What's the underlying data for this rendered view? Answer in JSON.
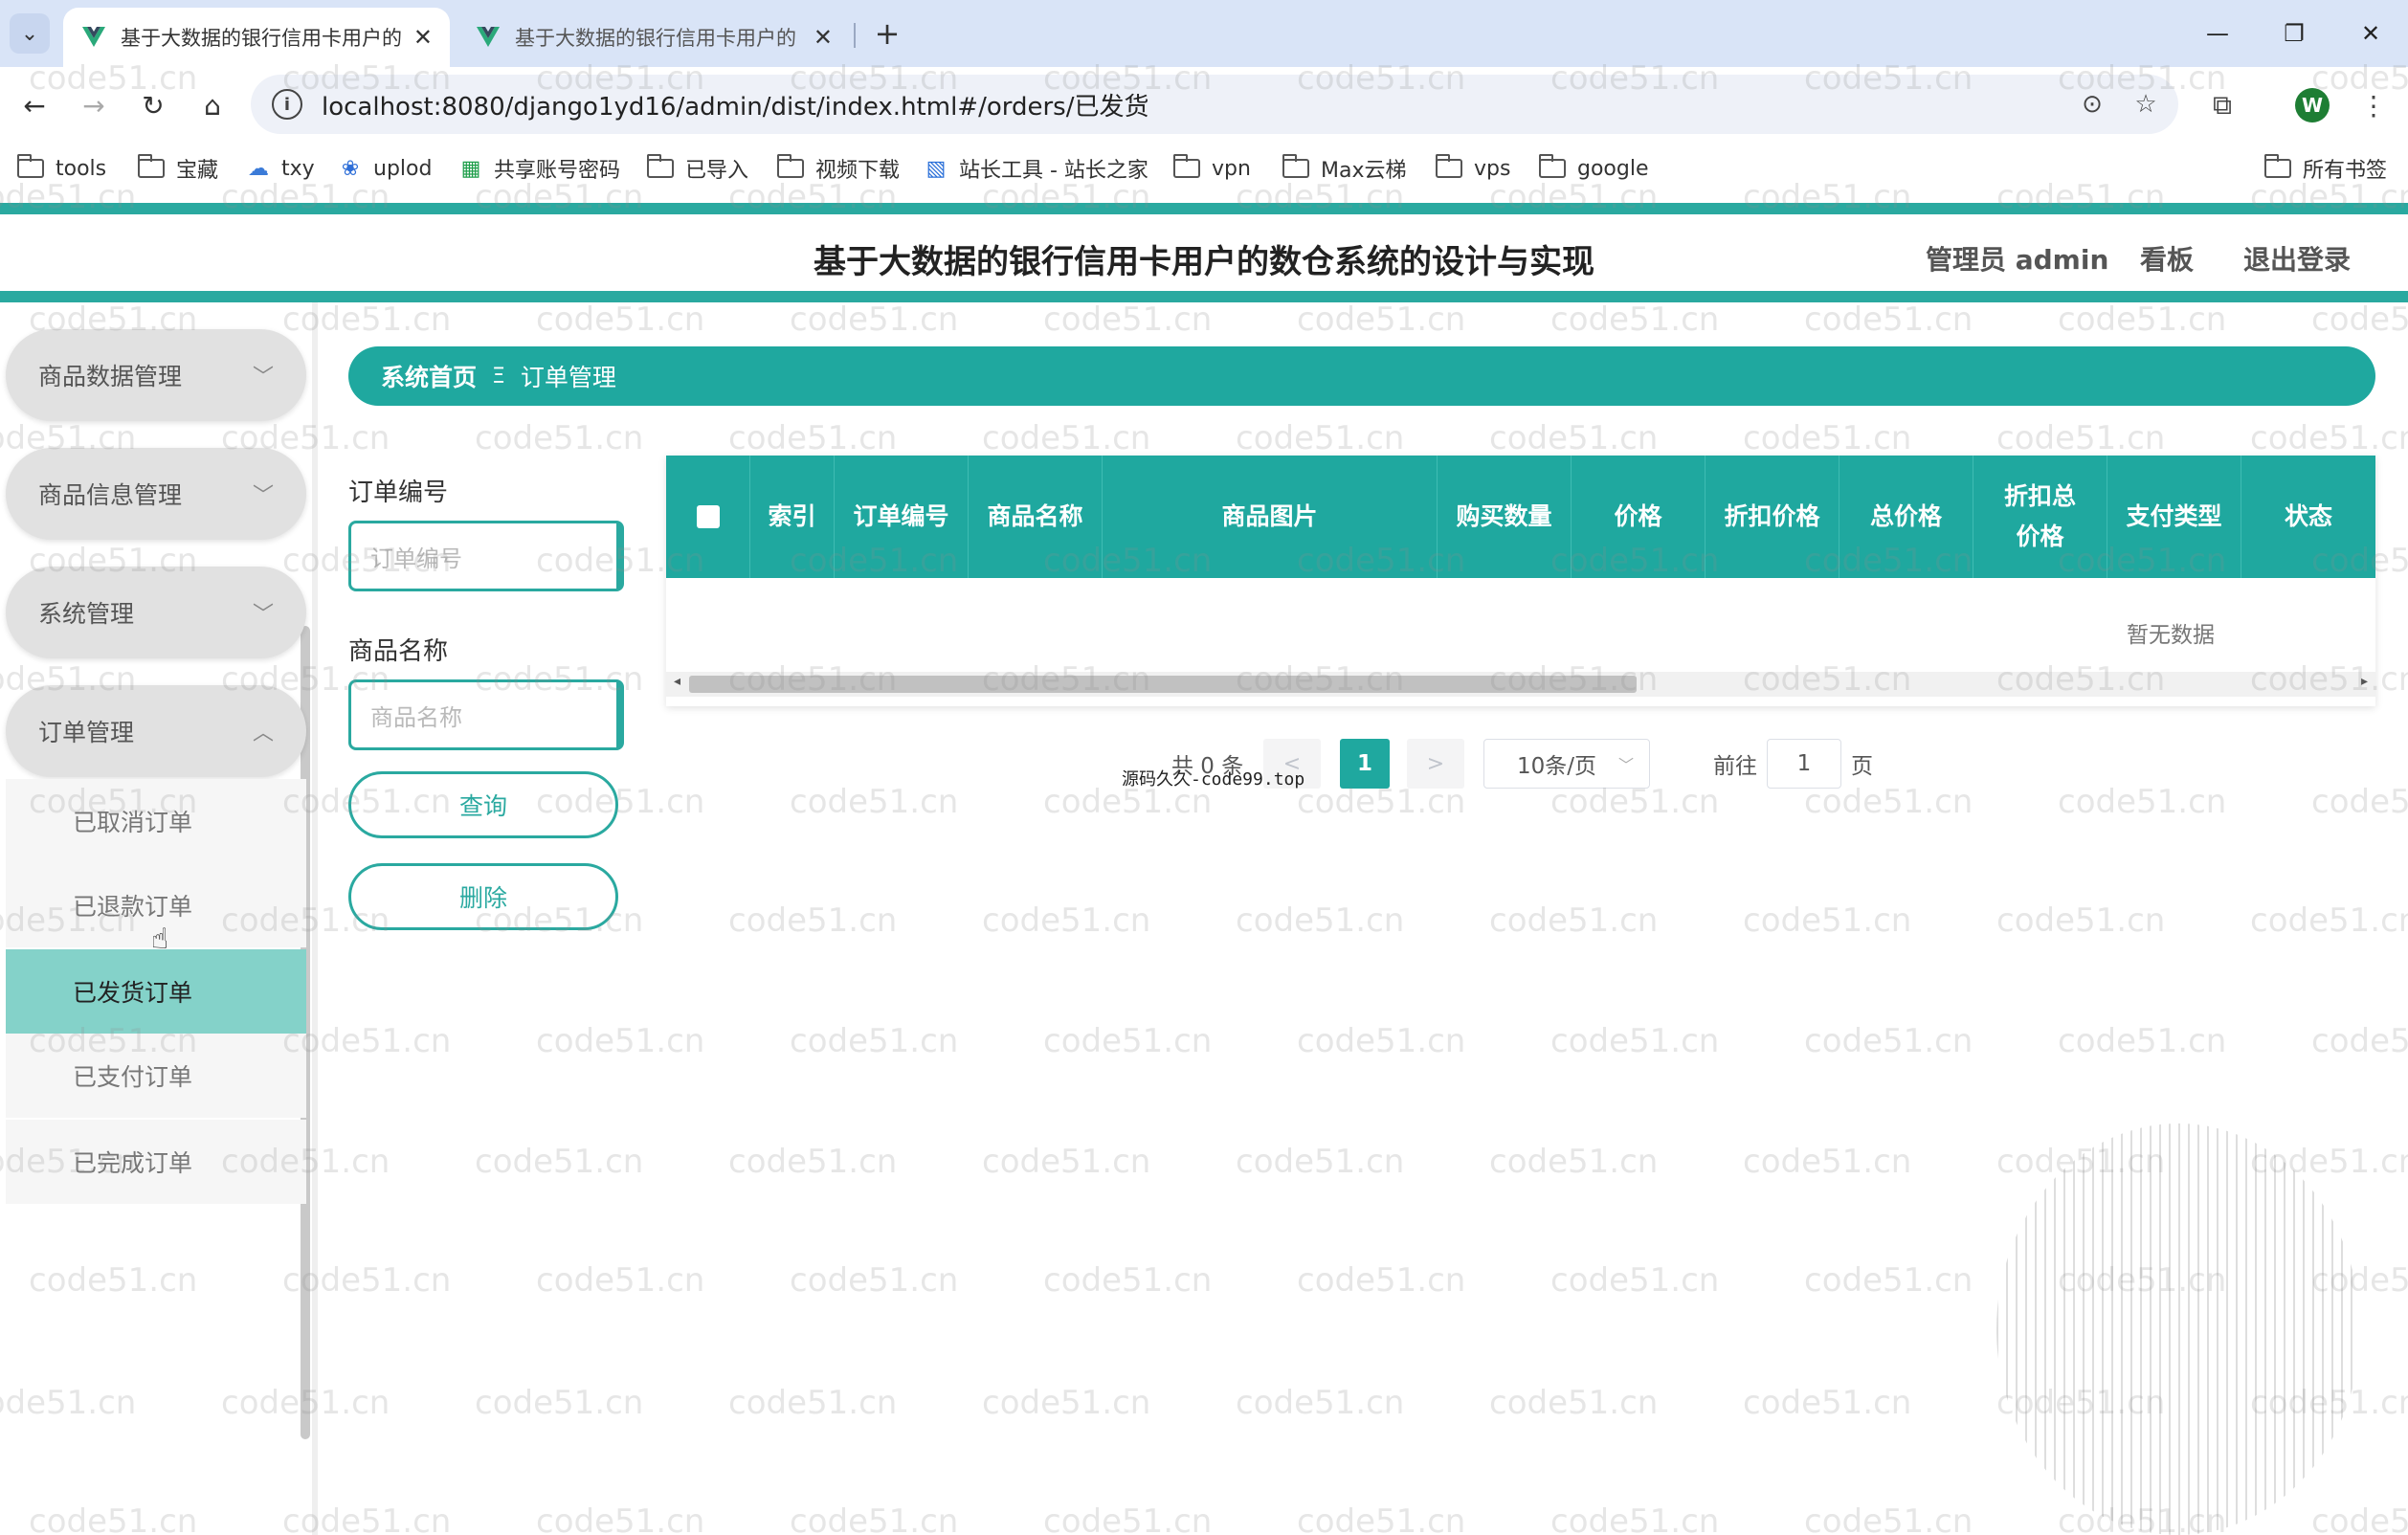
{
  "browser": {
    "tabs": [
      {
        "title": "基于大数据的银行信用卡用户的",
        "active": true
      },
      {
        "title": "基于大数据的银行信用卡用户的",
        "active": false
      }
    ],
    "url": "localhost:8080/django1yd16/admin/dist/index.html#/orders/已发货",
    "avatar_letter": "W",
    "bookmarks": [
      "tools",
      "宝藏",
      "txy",
      "uplod",
      "共享账号密码",
      "已导入",
      "视频下载",
      "站长工具 - 站长之家",
      "vpn",
      "Max云梯",
      "vps",
      "google"
    ],
    "all_bookmarks": "所有书签"
  },
  "header": {
    "title": "基于大数据的银行信用卡用户的数仓系统的设计与实现",
    "user": "管理员 admin",
    "dashboard": "看板",
    "logout": "退出登录"
  },
  "sidebar": {
    "menus": [
      {
        "label": "商品数据管理",
        "chevron": "﹀"
      },
      {
        "label": "商品信息管理",
        "chevron": "﹀"
      },
      {
        "label": "系统管理",
        "chevron": "﹀"
      },
      {
        "label": "订单管理",
        "chevron": "︿"
      }
    ],
    "submenus": [
      "已取消订单",
      "已退款订单",
      "已发货订单",
      "已支付订单",
      "已完成订单"
    ],
    "active_submenu": "已发货订单"
  },
  "breadcrumb": {
    "home": "系统首页",
    "separator": "Ξ",
    "current": "订单管理"
  },
  "search": {
    "order_no_label": "订单编号",
    "order_no_placeholder": "订单编号",
    "product_name_label": "商品名称",
    "product_name_placeholder": "商品名称",
    "query_button": "查询",
    "delete_button": "删除"
  },
  "table": {
    "columns": [
      "索引",
      "订单编号",
      "商品名称",
      "商品图片",
      "购买数量",
      "价格",
      "折扣价格",
      "总价格",
      "折扣总价格",
      "支付类型",
      "状态"
    ],
    "empty_text": "暂无数据"
  },
  "pagination": {
    "total": "共 0 条",
    "prev": "<",
    "current_page": "1",
    "next": ">",
    "page_size": "10条/页",
    "goto_label": "前往",
    "goto_value": "1",
    "page_suffix": "页"
  },
  "overlay_note": "源码久久-code99.top",
  "watermark": "code51.cn",
  "colors": {
    "accent": "#1fa89f",
    "sidebar_active": "#84d2c9",
    "tabstrip": "#d9e4f7"
  }
}
